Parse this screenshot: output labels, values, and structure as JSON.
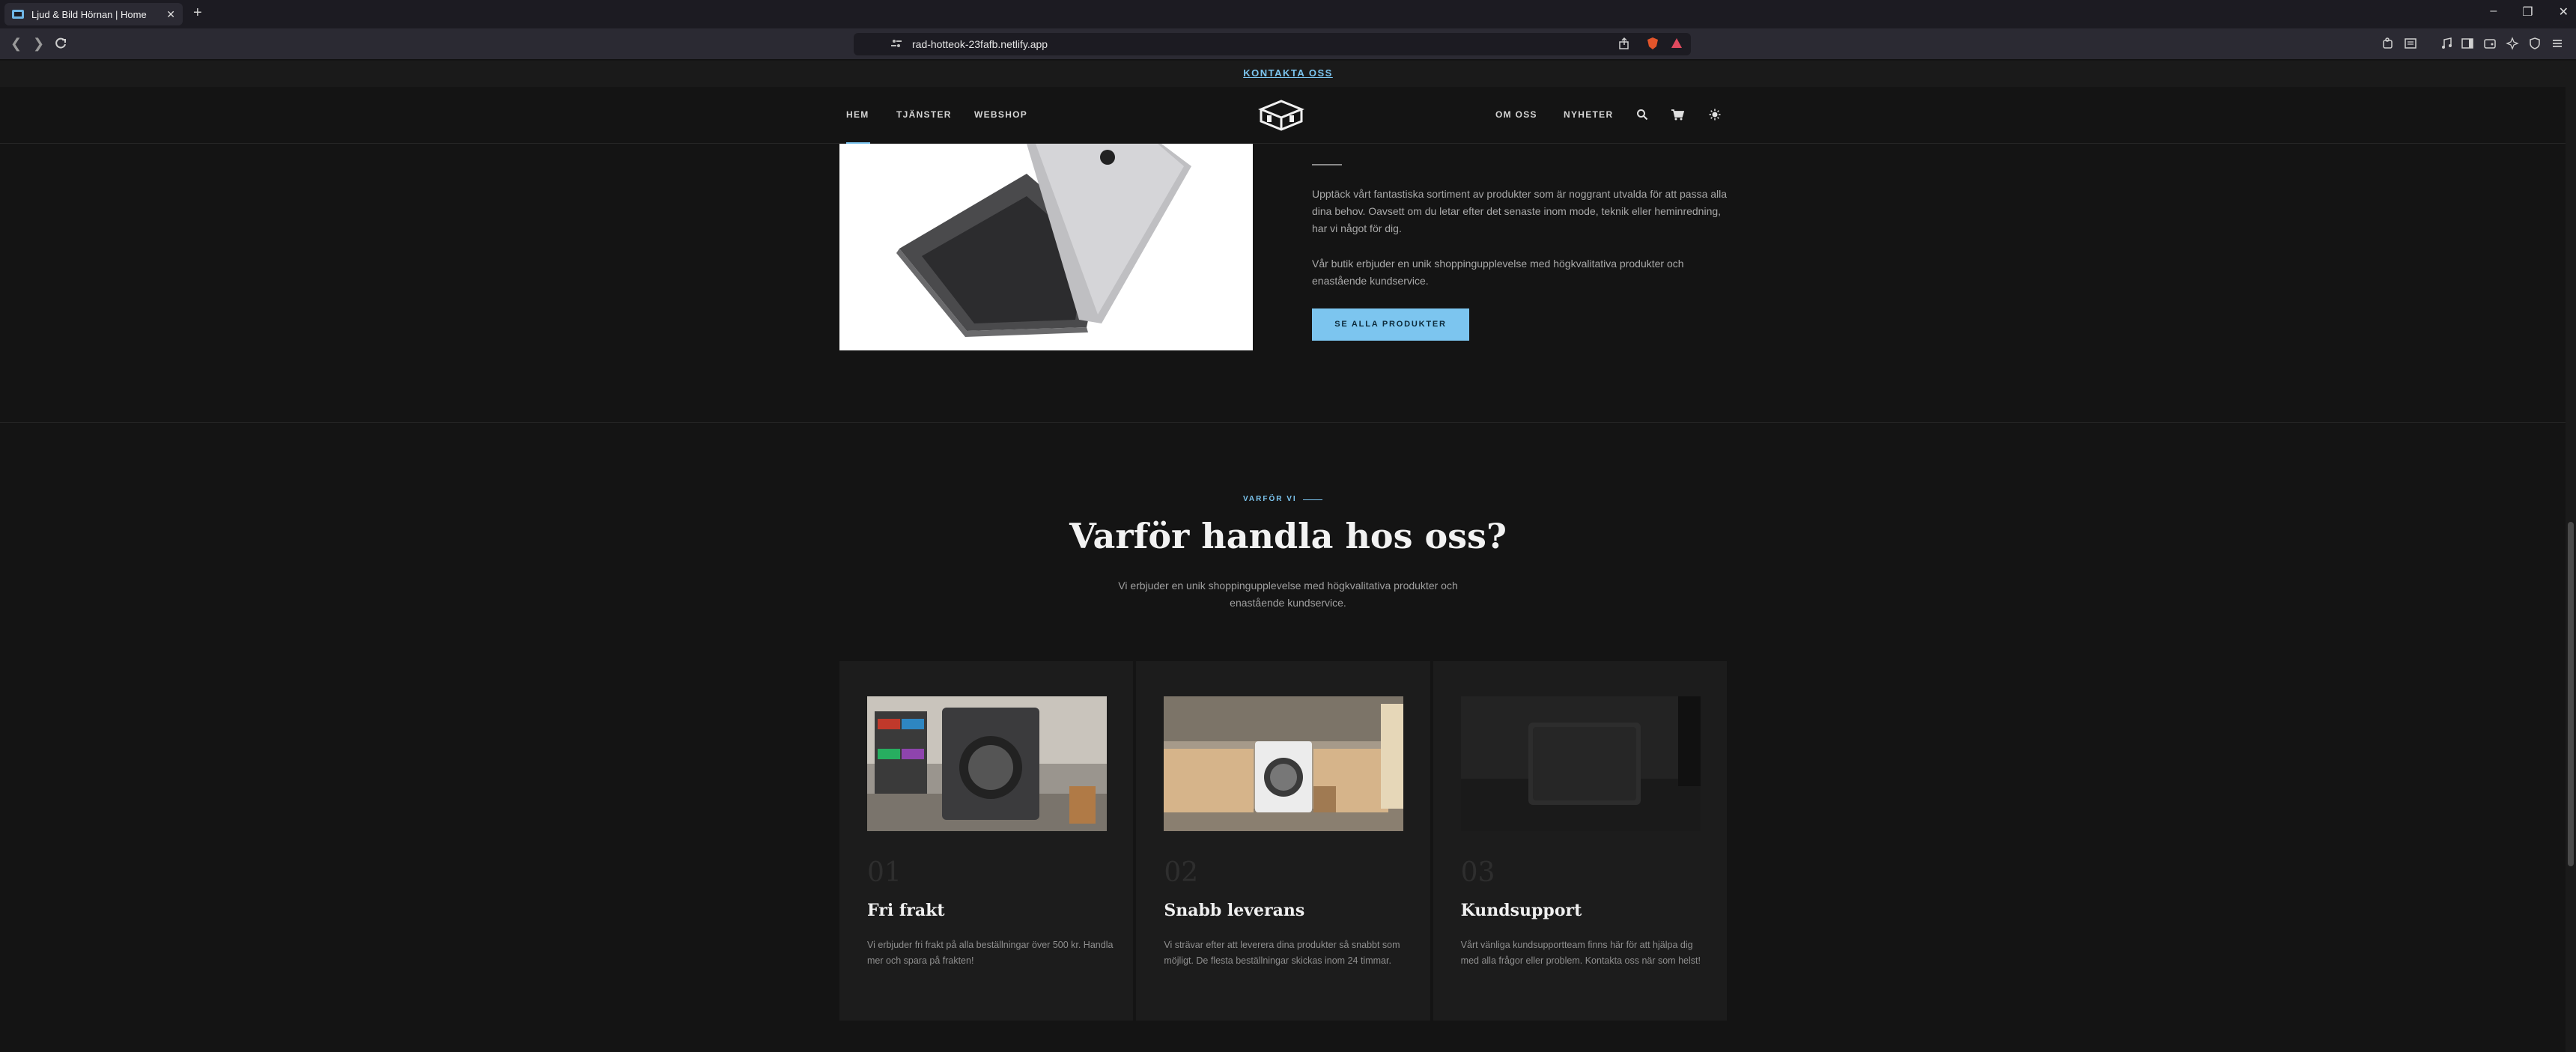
{
  "browser": {
    "tab_title": "Ljud & Bild Hörnan | Home",
    "tab_close": "✕",
    "new_tab": "+",
    "url": "rad-hotteok-23fafb.netlify.app",
    "win_min": "–",
    "win_max": "❐",
    "win_close": "✕"
  },
  "site": {
    "announcement": "KONTAKTA OSS",
    "nav_left": [
      "HEM",
      "TJÄNSTER",
      "WEBSHOP"
    ],
    "nav_right": [
      "OM OSS",
      "NYHETER"
    ],
    "hero": {
      "paragraph1": "Upptäck vårt fantastiska sortiment av produkter som är noggrant utvalda för att passa alla dina behov. Oavsett om du letar efter det senaste inom mode, teknik eller heminredning, har vi något för dig.",
      "paragraph2": "Vår butik erbjuder en unik shoppingupplevelse med högkvalitativa produkter och enastående kundservice.",
      "button": "SE ALLA PRODUKTER"
    },
    "why": {
      "eyebrow": "VARFÖR VI",
      "title": "Varför handla hos oss?",
      "subtitle": "Vi erbjuder en unik shoppingupplevelse med högkvalitativa produkter och enastående kundservice.",
      "cards": [
        {
          "number": "01",
          "title": "Fri frakt",
          "text": "Vi erbjuder fri frakt på alla beställningar över 500 kr. Handla mer och spara på frakten!"
        },
        {
          "number": "02",
          "title": "Snabb leverans",
          "text": "Vi strävar efter att leverera dina produkter så snabbt som möjligt. De flesta beställningar skickas inom 24 timmar."
        },
        {
          "number": "03",
          "title": "Kundsupport",
          "text": "Vårt vänliga kundsupportteam finns här för att hjälpa dig med alla frågor eller problem. Kontakta oss när som helst!"
        }
      ]
    }
  },
  "colors": {
    "accent": "#7cc5ef",
    "background": "#141414",
    "card": "#1c1c1c"
  }
}
